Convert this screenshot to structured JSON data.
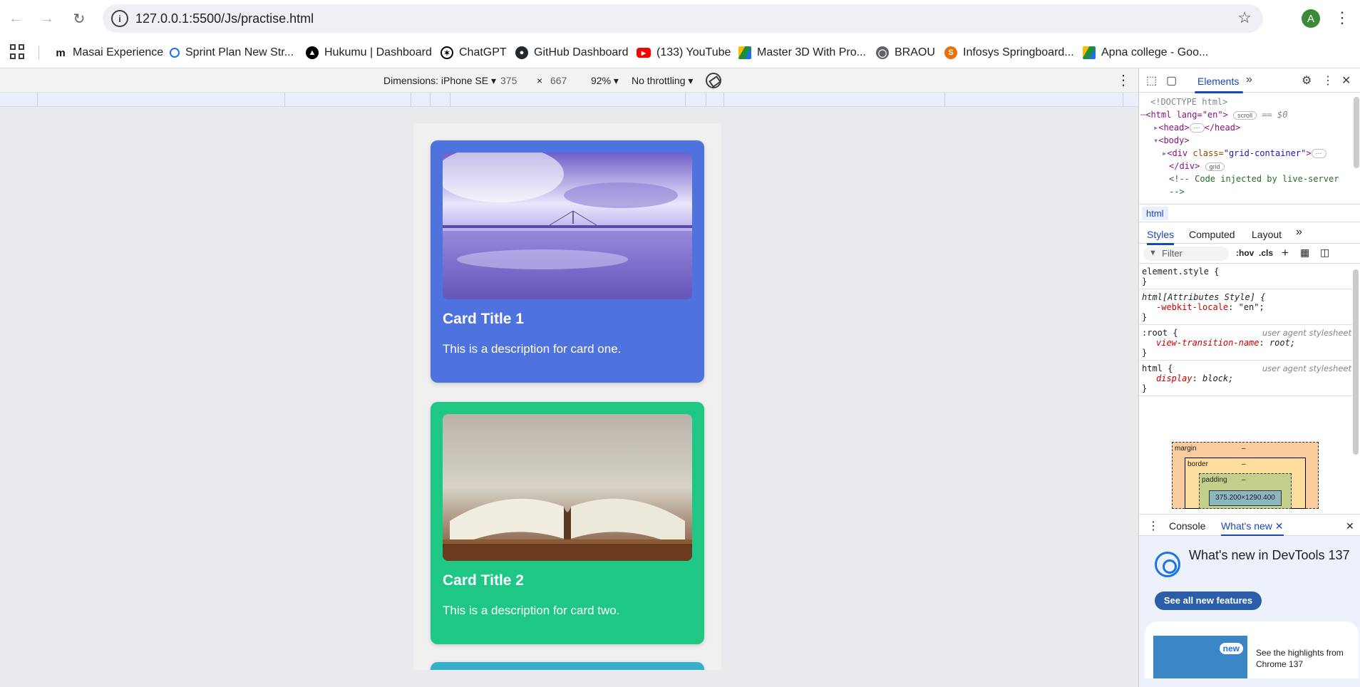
{
  "browser": {
    "url": "127.0.0.1:5500/Js/practise.html",
    "avatar_letter": "A"
  },
  "bookmarks": [
    {
      "label": "Masai Experience",
      "icon": "masai-icon",
      "color": "#111111"
    },
    {
      "label": "Sprint Plan New Str...",
      "icon": "pin-icon",
      "color": "#1a73e8"
    },
    {
      "label": "Hukumu | Dashboard",
      "icon": "hukumu-icon",
      "color": "#000000"
    },
    {
      "label": "ChatGPT",
      "icon": "chatgpt-icon",
      "color": "#000000"
    },
    {
      "label": "GitHub Dashboard",
      "icon": "github-icon",
      "color": "#24292f"
    },
    {
      "label": "(133) YouTube",
      "icon": "youtube-icon",
      "color": "#ff0000"
    },
    {
      "label": "Master 3D With Pro...",
      "icon": "drive-icon",
      "color": "#1e8e3e"
    },
    {
      "label": "BRAOU",
      "icon": "globe-icon",
      "color": "#5f6368"
    },
    {
      "label": "Infosys Springboard...",
      "icon": "infosys-icon",
      "color": "#e8710a"
    },
    {
      "label": "Apna college - Goo...",
      "icon": "drive-icon",
      "color": "#1e8e3e"
    }
  ],
  "device_toolbar": {
    "dimensions_label": "Dimensions: iPhone SE",
    "width": "375",
    "times": "×",
    "height": "667",
    "zoom": "92%",
    "throttling": "No throttling"
  },
  "cards": [
    {
      "title": "Card Title 1",
      "description": "This is a description for card one.",
      "color": "#4e72de",
      "image": "sea-bridge-image"
    },
    {
      "title": "Card Title 2",
      "description": "This is a description for card two.",
      "color": "#1fc785",
      "image": "open-book-image"
    },
    {
      "title": "",
      "description": "",
      "color": "#36b0c9",
      "image": ""
    }
  ],
  "devtools": {
    "main_tab": "Elements",
    "dom": {
      "doctype": "<!DOCTYPE html>",
      "html_open": "<html lang=\"en\">",
      "scroll_pill": "scroll",
      "eq": "== $0",
      "head": "<head>",
      "head_close": "</head>",
      "body": "<body>",
      "div_open_tag": "<div ",
      "div_class_attr": "class=",
      "div_class_val": "\"grid-container\"",
      "div_close": "</div>",
      "grid_pill": "grid",
      "comment1": "<!-- Code injected by live-server",
      "comment2": "-->"
    },
    "breadcrumb": "html",
    "sub_tabs": [
      "Styles",
      "Computed",
      "Layout"
    ],
    "filter_placeholder": "Filter",
    "hov": ":hov",
    "cls": ".cls",
    "rules": [
      {
        "selector": "element.style {",
        "source": "",
        "props": [],
        "close": "}"
      },
      {
        "selector": "html[Attributes Style] {",
        "source": "",
        "props": [
          {
            "name": "-webkit-locale",
            "value": "\"en\";"
          }
        ],
        "close": "}"
      },
      {
        "selector": ":root {",
        "source": "user agent stylesheet",
        "props": [
          {
            "name": "view-transition-name",
            "value": "root;"
          }
        ],
        "close": "}"
      },
      {
        "selector": "html {",
        "source": "user agent stylesheet",
        "props": [
          {
            "name": "display",
            "value": "block;"
          }
        ],
        "close": "}"
      }
    ],
    "box_model": {
      "margin": "margin",
      "border": "border",
      "padding": "padding",
      "dash": "–",
      "content": "375.200×1290.400"
    },
    "drawer": {
      "tabs": [
        "Console",
        "What's new"
      ],
      "title": "What's new in DevTools 137",
      "button": "See all new features",
      "badge": "new",
      "highlights": "See the highlights from Chrome 137"
    }
  }
}
